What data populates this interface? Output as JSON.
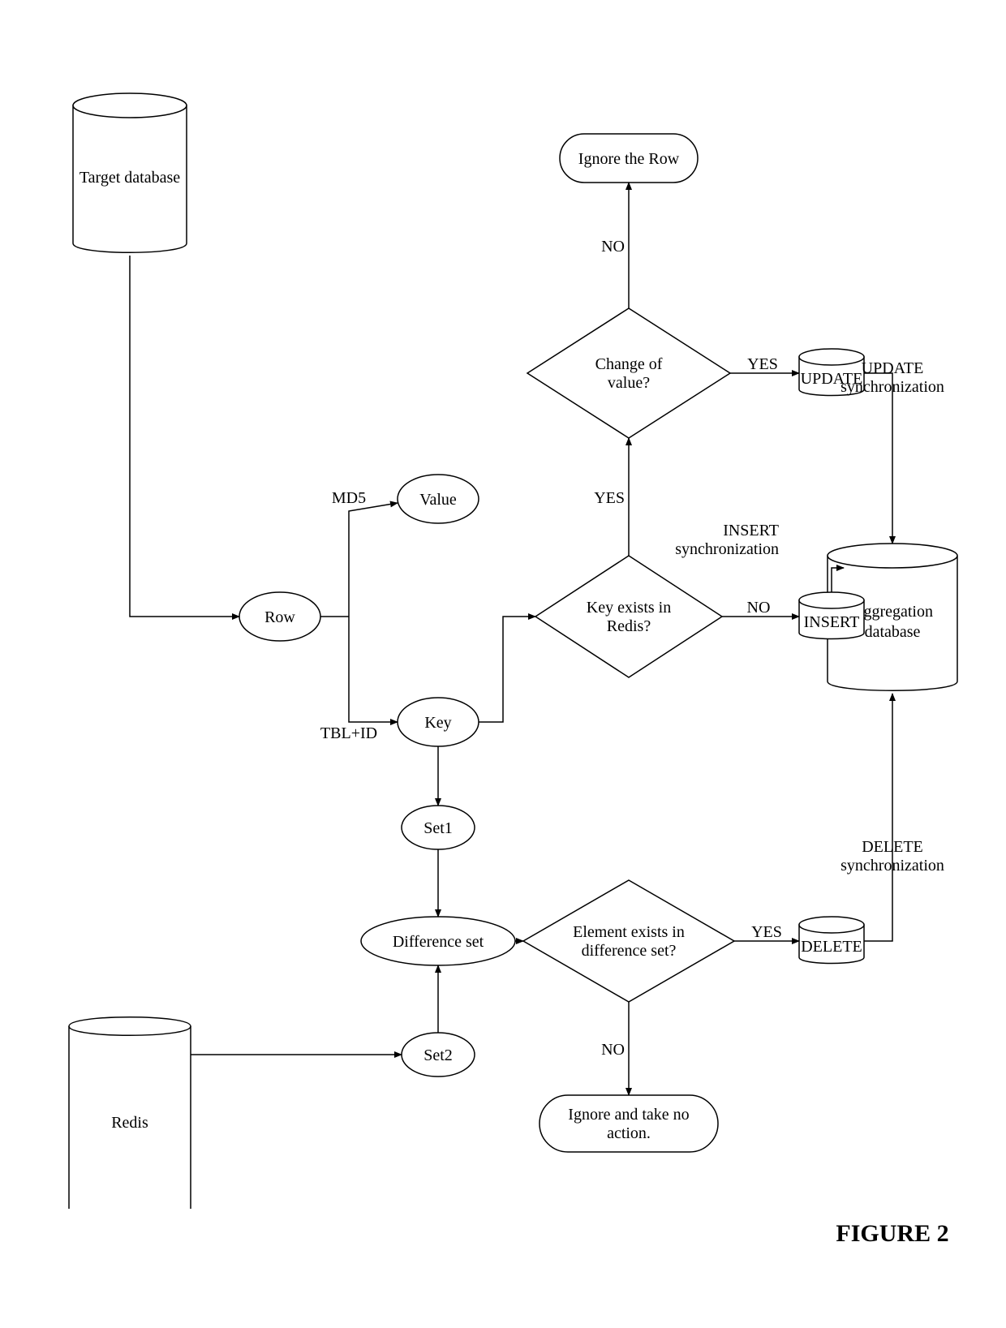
{
  "title": "FIGURE 2",
  "nodes": {
    "target_db": "Target database",
    "row": "Row",
    "value": "Value",
    "key": "Key",
    "md5": "MD5",
    "tbl_id": "TBL+ID",
    "key_exists": "Key exists in Redis?",
    "change_value": "Change of value?",
    "ignore_row": "Ignore the Row",
    "update": "UPDATE",
    "insert": "INSERT",
    "update_sync": "UPDATE synchronization",
    "insert_sync": "INSERT synchronization",
    "agg_db": "Aggregation database",
    "set1": "Set1",
    "set2": "Set2",
    "diff_set": "Difference set",
    "redis": "Redis",
    "elem_exists": "Element exists in difference set?",
    "delete": "DELETE",
    "delete_sync": "DELETE synchronization",
    "ignore_action": "Ignore and take no action."
  },
  "labels": {
    "yes": "YES",
    "no": "NO"
  }
}
